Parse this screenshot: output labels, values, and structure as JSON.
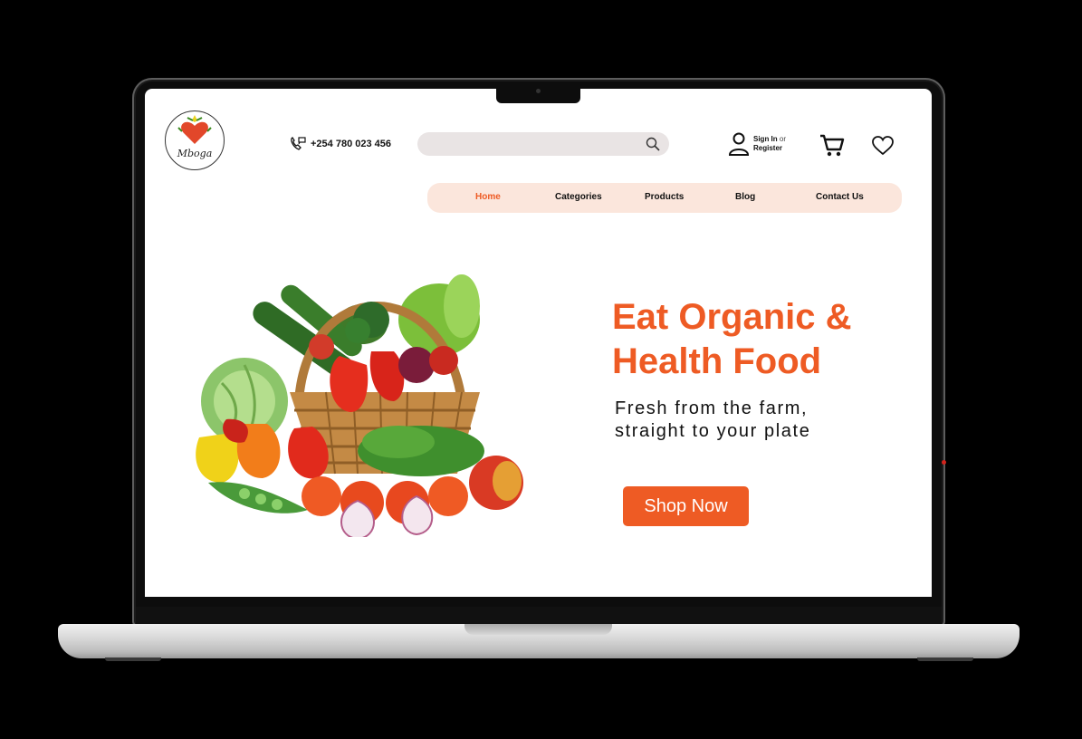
{
  "brand": {
    "logo_text": "Mboga"
  },
  "header": {
    "phone": "+254 780 023 456",
    "search_placeholder": "",
    "account": {
      "sign_in": "Sign In",
      "or": "or",
      "register": "Register"
    }
  },
  "nav": {
    "items": [
      {
        "label": "Home",
        "active": true
      },
      {
        "label": "Categories",
        "active": false
      },
      {
        "label": "Products",
        "active": false
      },
      {
        "label": "Blog",
        "active": false
      },
      {
        "label": "Contact Us",
        "active": false
      }
    ]
  },
  "hero": {
    "title_line1": "Eat Organic &",
    "title_line2": "Health Food",
    "subtitle_line1": "Fresh from the farm,",
    "subtitle_line2": "straight to your plate",
    "cta": "Shop Now"
  },
  "colors": {
    "accent": "#ee5b24",
    "nav_bg": "#fbe6dc",
    "search_bg": "#e9e4e4"
  },
  "icons": [
    "phone-icon",
    "search-icon",
    "user-icon",
    "cart-icon",
    "heart-icon"
  ]
}
